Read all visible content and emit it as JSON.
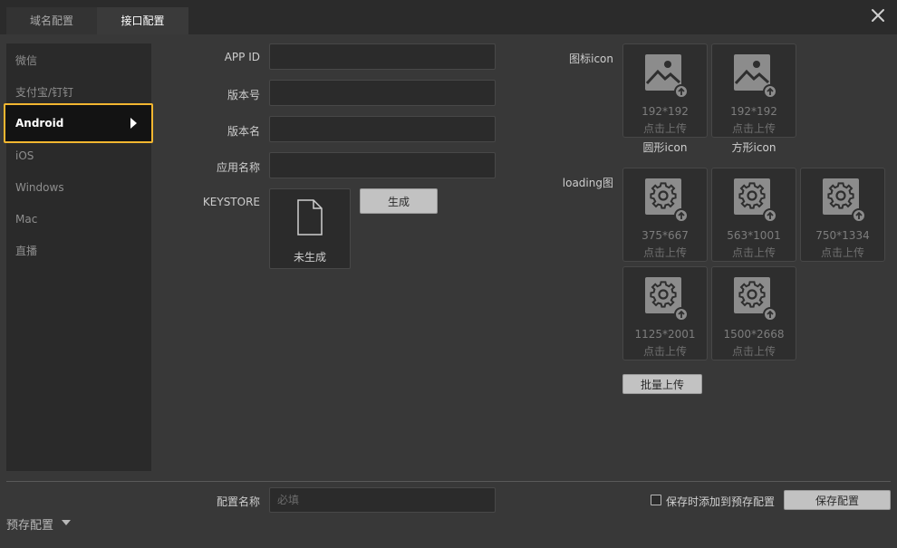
{
  "tabs": [
    {
      "label": "域名配置"
    },
    {
      "label": "接口配置"
    }
  ],
  "sidebar": {
    "items": [
      {
        "label": "微信"
      },
      {
        "label": "支付宝/钉钉"
      },
      {
        "label": "Android"
      },
      {
        "label": "iOS"
      },
      {
        "label": "Windows"
      },
      {
        "label": "Mac"
      },
      {
        "label": "直播"
      }
    ]
  },
  "form": {
    "app_id_label": "APP ID",
    "app_id_value": "",
    "version_code_label": "版本号",
    "version_code_value": "",
    "version_name_label": "版本名",
    "version_name_value": "",
    "app_name_label": "应用名称",
    "app_name_value": "",
    "keystore_label": "KEYSTORE",
    "keystore_status": "未生成",
    "generate_label": "生成"
  },
  "icons_section": {
    "label": "图标icon",
    "items": [
      {
        "size": "192*192",
        "hint": "点击上传",
        "caption": "圆形icon"
      },
      {
        "size": "192*192",
        "hint": "点击上传",
        "caption": "方形icon"
      }
    ]
  },
  "loading_section": {
    "label": "loading图",
    "items": [
      {
        "size": "375*667",
        "hint": "点击上传"
      },
      {
        "size": "563*1001",
        "hint": "点击上传"
      },
      {
        "size": "750*1334",
        "hint": "点击上传"
      },
      {
        "size": "1125*2001",
        "hint": "点击上传"
      },
      {
        "size": "1500*2668",
        "hint": "点击上传"
      }
    ],
    "batch_upload_label": "批量上传"
  },
  "footer": {
    "config_name_label": "配置名称",
    "config_name_placeholder": "必填",
    "config_name_value": "",
    "save_to_preset_label": "保存时添加到预存配置",
    "save_button_label": "保存配置",
    "preset_label": "预存配置"
  }
}
